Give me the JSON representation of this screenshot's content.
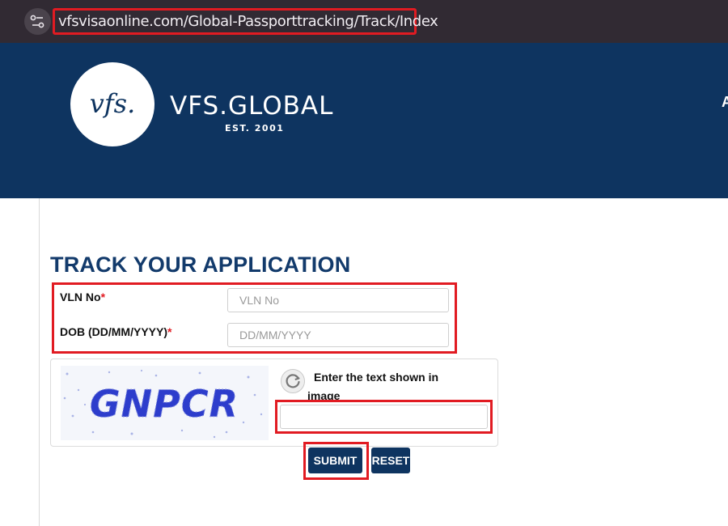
{
  "browser": {
    "url": "vfsvisaonline.com/Global-Passporttracking/Track/Index",
    "site_info_icon": "tune-icon"
  },
  "header": {
    "logo_mark": "vfs.",
    "brand": "VFS.GLOBAL",
    "est": "EST. 2001",
    "nav_partial": "A"
  },
  "main": {
    "title": "TRACK YOUR APPLICATION",
    "vln": {
      "label": "VLN No",
      "required": "*",
      "placeholder": "VLN No",
      "value": ""
    },
    "dob": {
      "label": "DOB (DD/MM/YYYY)",
      "required": "*",
      "placeholder": "DD/MM/YYYY",
      "value": ""
    },
    "captcha": {
      "code": "GNPCR",
      "instruction": "Enter the text shown in image",
      "refresh_icon": "refresh-icon",
      "value": ""
    },
    "buttons": {
      "submit": "SUBMIT",
      "reset": "RESET"
    }
  },
  "colors": {
    "header_bg": "#0e3460",
    "title": "#123a6b",
    "highlight": "#e11b22",
    "required": "#e11b22"
  }
}
